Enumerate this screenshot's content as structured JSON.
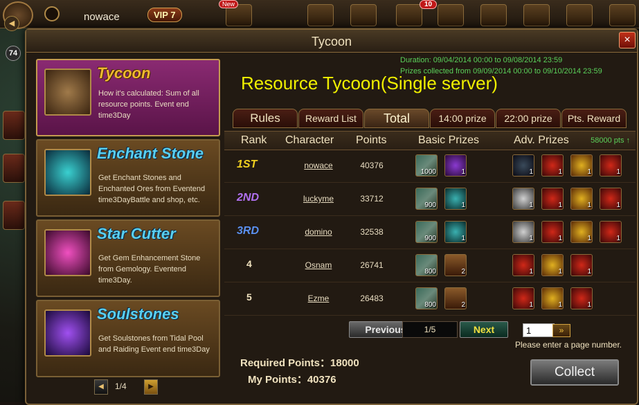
{
  "topbar": {
    "player_name": "nowace",
    "vip": "VIP 7",
    "level": "74",
    "badge_new": "New",
    "badge_count": "10"
  },
  "modal": {
    "title": "Tycoon",
    "close_label": "×"
  },
  "duration": {
    "line1": "Duration: 09/04/2014 00:00 to 09/08/2014 23:59",
    "line2": "Prizes collected from 09/09/2014 00:00 to 09/10/2014 23:59"
  },
  "main_title": "Resource Tycoon(Single server)",
  "events": [
    {
      "title": "Tycoon",
      "desc": "How it's calculated: Sum of all resource points. Event end time3Day"
    },
    {
      "title": "Enchant Stone",
      "desc": "Get Enchant Stones and Enchanted Ores from Eventend time3DayBattle and shop, etc."
    },
    {
      "title": "Star Cutter",
      "desc": "Get Gem Enhancement Stone from Gemology. Eventend time3Day."
    },
    {
      "title": "Soulstones",
      "desc": "Get Soulstones from Tidal Pool and Raiding Event end time3Day"
    }
  ],
  "events_pager": {
    "page": "1/4",
    "prev": "◀",
    "next": "▶"
  },
  "tabs": [
    "Rules",
    "Reward List",
    "Total",
    "14:00 prize",
    "22:00 prize",
    "Pts. Reward"
  ],
  "table": {
    "headers": {
      "rank": "Rank",
      "character": "Character",
      "points": "Points",
      "basic": "Basic Prizes",
      "adv": "Adv. Prizes"
    },
    "pts_link": "58000 pts ↑",
    "rows": [
      {
        "rank": "1ST",
        "character": "nowace",
        "points": "40376",
        "basic": [
          {
            "qty": "1000"
          },
          {
            "qty": "1"
          }
        ],
        "adv": [
          {
            "qty": "1"
          },
          {
            "qty": "1"
          },
          {
            "qty": "1"
          },
          {
            "qty": "1"
          }
        ]
      },
      {
        "rank": "2ND",
        "character": "luckyme",
        "points": "33712",
        "basic": [
          {
            "qty": "900"
          },
          {
            "qty": "1"
          }
        ],
        "adv": [
          {
            "qty": "1"
          },
          {
            "qty": "1"
          },
          {
            "qty": "1"
          },
          {
            "qty": "1"
          }
        ]
      },
      {
        "rank": "3RD",
        "character": "domino",
        "points": "32538",
        "basic": [
          {
            "qty": "900"
          },
          {
            "qty": "1"
          }
        ],
        "adv": [
          {
            "qty": "1"
          },
          {
            "qty": "1"
          },
          {
            "qty": "1"
          },
          {
            "qty": "1"
          }
        ]
      },
      {
        "rank": "4",
        "character": "Osnam",
        "points": "26741",
        "basic": [
          {
            "qty": "800"
          },
          {
            "qty": "2"
          }
        ],
        "adv": [
          {
            "qty": "1"
          },
          {
            "qty": "1"
          },
          {
            "qty": "1"
          }
        ]
      },
      {
        "rank": "5",
        "character": "Ezme",
        "points": "26483",
        "basic": [
          {
            "qty": "800"
          },
          {
            "qty": "2"
          }
        ],
        "adv": [
          {
            "qty": "1"
          },
          {
            "qty": "1"
          },
          {
            "qty": "1"
          }
        ]
      }
    ]
  },
  "pager": {
    "prev": "Previous",
    "page": "1/5",
    "next": "Next",
    "input_value": "1",
    "go": "»",
    "hint": "Please enter a page number."
  },
  "required_points": "Required Points：18000",
  "my_points": "My Points：40376",
  "collect_label": "Collect",
  "colors": {
    "accent_title": "#f0f000",
    "duration_green": "#5ad05a",
    "active_event": "#8a2a72"
  }
}
